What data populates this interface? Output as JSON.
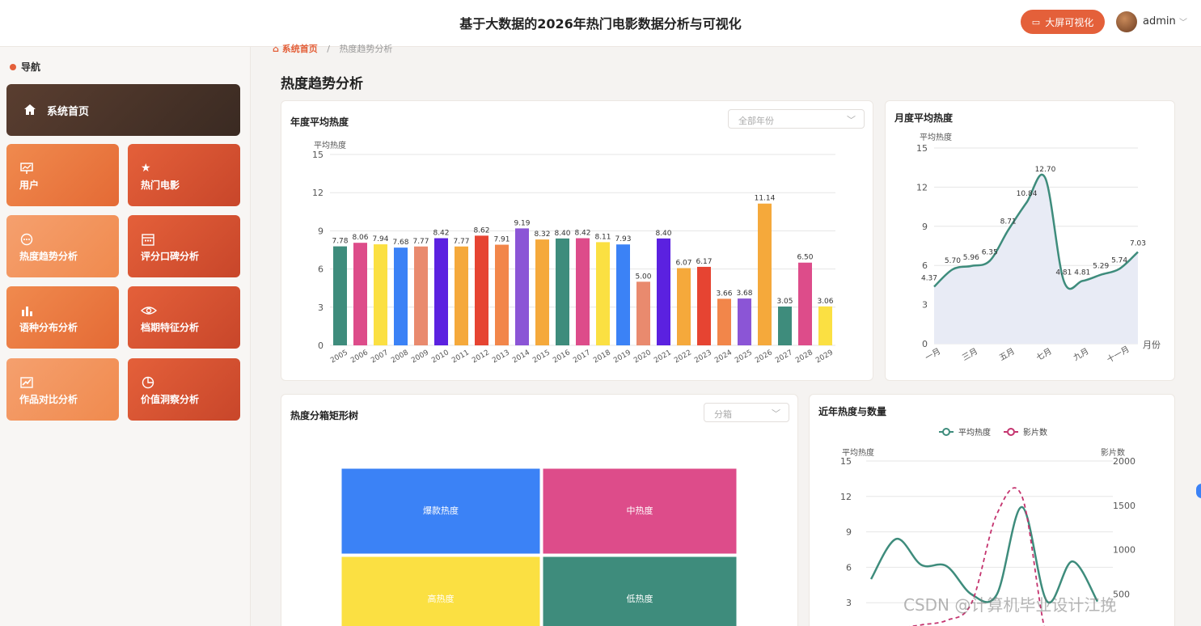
{
  "header": {
    "title": "基于大数据的2026年热门电影数据分析与可视化",
    "big_screen_label": "大屏可视化",
    "username": "admin"
  },
  "sidebar": {
    "title": "导航",
    "home": "系统首页",
    "items": [
      {
        "label": "用户",
        "icon": "presentation-icon"
      },
      {
        "label": "热门电影",
        "icon": "star-icon"
      },
      {
        "label": "热度趋势分析",
        "icon": "chat-icon"
      },
      {
        "label": "评分口碑分析",
        "icon": "calendar-icon"
      },
      {
        "label": "语种分布分析",
        "icon": "bar-chart-icon"
      },
      {
        "label": "档期特征分析",
        "icon": "eye-icon"
      },
      {
        "label": "作品对比分析",
        "icon": "trend-icon"
      },
      {
        "label": "价值洞察分析",
        "icon": "pie-icon"
      }
    ]
  },
  "breadcrumb": {
    "home": "系统首页",
    "sep": "/",
    "current": "热度趋势分析"
  },
  "page_title": "热度趋势分析",
  "cards": {
    "yearly": {
      "title": "年度平均热度",
      "select": "全部年份"
    },
    "monthly": {
      "title": "月度平均热度"
    },
    "treemap": {
      "title": "热度分箱矩形树",
      "select": "分箱"
    },
    "recent": {
      "title": "近年热度与数量"
    }
  },
  "watermark": "CSDN @计算机毕业设计江挽",
  "chart_data": [
    {
      "type": "bar",
      "title": "年度平均热度",
      "ylabel": "平均热度",
      "ylim": [
        0,
        15
      ],
      "yticks": [
        0,
        3,
        6,
        9,
        12,
        15
      ],
      "categories": [
        "2005",
        "2006",
        "2007",
        "2008",
        "2009",
        "2010",
        "2011",
        "2012",
        "2013",
        "2014",
        "2015",
        "2016",
        "2017",
        "2018",
        "2019",
        "2020",
        "2021",
        "2022",
        "2023",
        "2024",
        "2025",
        "2026",
        "2027",
        "2028",
        "2029"
      ],
      "values": [
        7.78,
        8.06,
        7.94,
        7.68,
        7.77,
        8.42,
        7.77,
        8.62,
        7.91,
        9.19,
        8.32,
        8.4,
        8.42,
        8.11,
        7.93,
        5.0,
        8.4,
        6.07,
        6.17,
        3.66,
        3.68,
        11.14,
        3.05,
        6.5,
        3.06
      ],
      "colors": [
        "#3e8c7c",
        "#dd4c8a",
        "#fbe042",
        "#3b82f6",
        "#e98a6e",
        "#5b21e0",
        "#f5a93b",
        "#e64432",
        "#f2864a",
        "#8b55d6",
        "#f5a93b",
        "#3e8c7c",
        "#dd4c8a",
        "#fbe042",
        "#3b82f6",
        "#e98a6e",
        "#5b21e0",
        "#f5a93b",
        "#e64432",
        "#f2864a",
        "#8b55d6",
        "#f5a93b",
        "#3e8c7c",
        "#dd4c8a",
        "#fbe042"
      ],
      "grid": true
    },
    {
      "type": "area",
      "title": "月度平均热度",
      "ylabel": "平均热度",
      "xlabel": "月份",
      "ylim": [
        0,
        15
      ],
      "yticks": [
        0,
        3,
        6,
        9,
        12,
        15
      ],
      "categories": [
        "一月",
        "二月",
        "三月",
        "四月",
        "五月",
        "六月",
        "七月",
        "八月",
        "九月",
        "十月",
        "十一月",
        "十二月"
      ],
      "xtick_labels": [
        "一月",
        "三月",
        "五月",
        "七月",
        "九月",
        "十一月"
      ],
      "values": [
        4.37,
        5.7,
        5.96,
        6.35,
        8.71,
        10.84,
        12.7,
        4.81,
        4.81,
        5.29,
        5.74,
        7.03
      ],
      "color": "#3e8c7c",
      "fill": "#e8ebf5",
      "grid": true
    },
    {
      "type": "treemap",
      "title": "热度分箱矩形树",
      "labels": [
        "爆款热度",
        "中热度",
        "高热度",
        "低热度"
      ],
      "colors": [
        "#3b82f6",
        "#dd4c8a",
        "#fbe042",
        "#3e8c7c"
      ]
    },
    {
      "type": "line",
      "title": "近年热度与数量",
      "ylabel": "平均热度",
      "ylabel_right": "影片数",
      "ylim": [
        0,
        15
      ],
      "yticks": [
        3,
        6,
        9,
        12,
        15
      ],
      "ylim_right": [
        0,
        2000
      ],
      "yticks_right": [
        500,
        1000,
        1500,
        2000
      ],
      "legend": "top-center",
      "series": [
        {
          "name": "平均热度",
          "axis": "left",
          "color": "#3e8c7c",
          "dash": false,
          "values": [
            5.0,
            8.4,
            6.2,
            6.1,
            3.7,
            3.7,
            11.1,
            3.1,
            6.5,
            3.1
          ]
        },
        {
          "name": "影片数",
          "axis": "right",
          "color": "#c4336e",
          "dash": true,
          "values": [
            0,
            100,
            150,
            200,
            400,
            1400,
            1600,
            0,
            0,
            0
          ]
        }
      ],
      "grid": true
    }
  ]
}
